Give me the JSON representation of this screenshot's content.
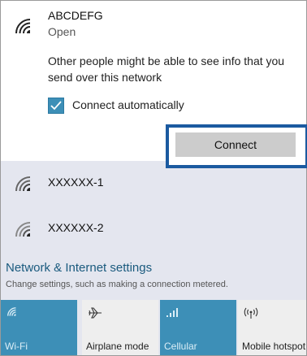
{
  "selected_network": {
    "name": "ABCDEFG",
    "status": "Open",
    "warning": "Other people might be able to see info that you send over this network",
    "connect_automatically": {
      "label": "Connect automatically",
      "checked": true
    },
    "connect_button": "Connect"
  },
  "networks": [
    {
      "name": "XXXXXX-1"
    },
    {
      "name": "XXXXXX-2"
    }
  ],
  "settings": {
    "link": "Network & Internet settings",
    "description": "Change settings, such as making a connection metered."
  },
  "quick_actions": [
    {
      "label": "Wi-Fi",
      "active": true,
      "icon": "wifi-icon"
    },
    {
      "label": "Airplane mode",
      "active": false,
      "icon": "airplane-icon"
    },
    {
      "label": "Cellular",
      "active": true,
      "icon": "cellular-icon"
    },
    {
      "label": "Mobile hotspot",
      "active": false,
      "icon": "hotspot-icon"
    }
  ],
  "colors": {
    "accent": "#3d8fb7",
    "highlight_border": "#1b5aa0",
    "link": "#1a5a7e",
    "panel_background": "#e4e6ef"
  }
}
